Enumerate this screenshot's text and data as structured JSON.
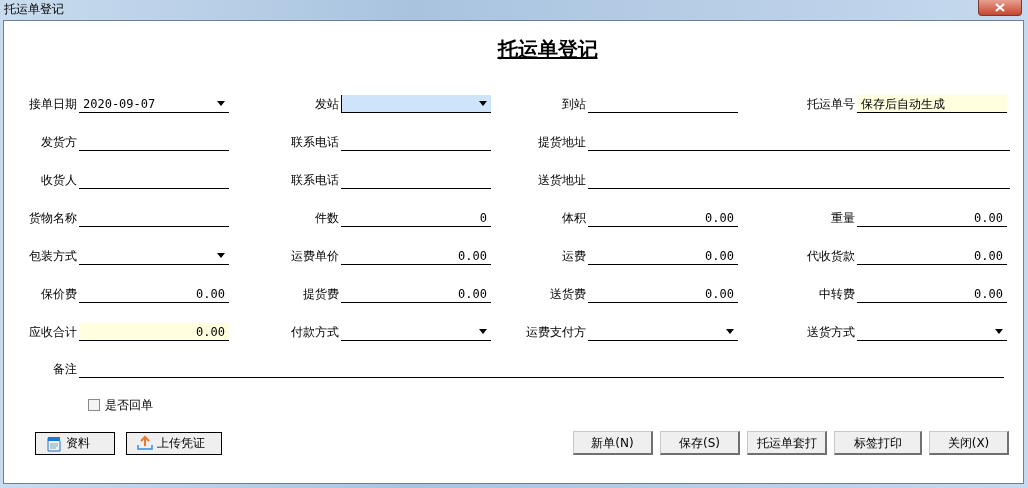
{
  "window": {
    "title": "托运单登记"
  },
  "form_title": "托运单登记",
  "rows": [
    [
      {
        "label": "接单日期",
        "value": "2020-09-07",
        "kind": "combo",
        "focused": false,
        "highlighted": false,
        "wide": false
      },
      {
        "label": "发站",
        "kind": "combo",
        "focused": true,
        "highlighted": false,
        "wide": false
      },
      {
        "label": "到站",
        "kind": "text",
        "focused": false,
        "highlighted": false,
        "wide": false
      },
      {
        "label": "托运单号",
        "value": "保存后自动生成",
        "kind": "text",
        "focused": false,
        "highlighted": true,
        "wide": false
      }
    ],
    [
      {
        "label": "发货方",
        "kind": "text",
        "focused": false,
        "highlighted": false,
        "wide": false
      },
      {
        "label": "联系电话",
        "kind": "text",
        "focused": false,
        "highlighted": false,
        "wide": false
      },
      {
        "label": "提货地址",
        "kind": "text",
        "focused": false,
        "highlighted": false,
        "wide": true
      }
    ],
    [
      {
        "label": "收货人",
        "kind": "text",
        "focused": false,
        "highlighted": false,
        "wide": false
      },
      {
        "label": "联系电话",
        "kind": "text",
        "focused": false,
        "highlighted": false,
        "wide": false
      },
      {
        "label": "送货地址",
        "kind": "text",
        "focused": false,
        "highlighted": false,
        "wide": true
      }
    ],
    [
      {
        "label": "货物名称",
        "kind": "text",
        "focused": false,
        "highlighted": false,
        "wide": false
      },
      {
        "label": "件数",
        "value": "0",
        "kind": "number",
        "focused": false,
        "highlighted": false,
        "wide": false
      },
      {
        "label": "体积",
        "value": "0.00",
        "kind": "number",
        "focused": false,
        "highlighted": false,
        "wide": false
      },
      {
        "label": "重量",
        "value": "0.00",
        "kind": "number",
        "focused": false,
        "highlighted": false,
        "wide": false
      }
    ],
    [
      {
        "label": "包装方式",
        "kind": "combo",
        "focused": false,
        "highlighted": false,
        "wide": false
      },
      {
        "label": "运费单价",
        "value": "0.00",
        "kind": "number",
        "focused": false,
        "highlighted": false,
        "wide": false
      },
      {
        "label": "运费",
        "value": "0.00",
        "kind": "number",
        "focused": false,
        "highlighted": false,
        "wide": false
      },
      {
        "label": "代收货款",
        "value": "0.00",
        "kind": "number",
        "focused": false,
        "highlighted": false,
        "wide": false
      }
    ],
    [
      {
        "label": "保价费",
        "value": "0.00",
        "kind": "number",
        "focused": false,
        "highlighted": false,
        "wide": false
      },
      {
        "label": "提货费",
        "value": "0.00",
        "kind": "number",
        "focused": false,
        "highlighted": false,
        "wide": false
      },
      {
        "label": "送货费",
        "value": "0.00",
        "kind": "number",
        "focused": false,
        "highlighted": false,
        "wide": false
      },
      {
        "label": "中转费",
        "value": "0.00",
        "kind": "number",
        "focused": false,
        "highlighted": false,
        "wide": false
      }
    ],
    [
      {
        "label": "应收合计",
        "value": "0.00",
        "kind": "number",
        "focused": false,
        "highlighted": true,
        "wide": false
      },
      {
        "label": "付款方式",
        "kind": "combo",
        "focused": false,
        "highlighted": false,
        "wide": false
      },
      {
        "label": "运费支付方",
        "kind": "combo",
        "focused": false,
        "highlighted": false,
        "wide": false
      },
      {
        "label": "送货方式",
        "kind": "combo",
        "focused": false,
        "highlighted": false,
        "wide": false
      }
    ]
  ],
  "remarks": {
    "label": "备注"
  },
  "return_receipt": {
    "label": "是否回单",
    "checked": false
  },
  "left_buttons": [
    "资料",
    "上传凭证"
  ],
  "right_buttons": [
    "新单(N)",
    "保存(S)",
    "托运单套打",
    "标签打印",
    "关闭(X)"
  ]
}
